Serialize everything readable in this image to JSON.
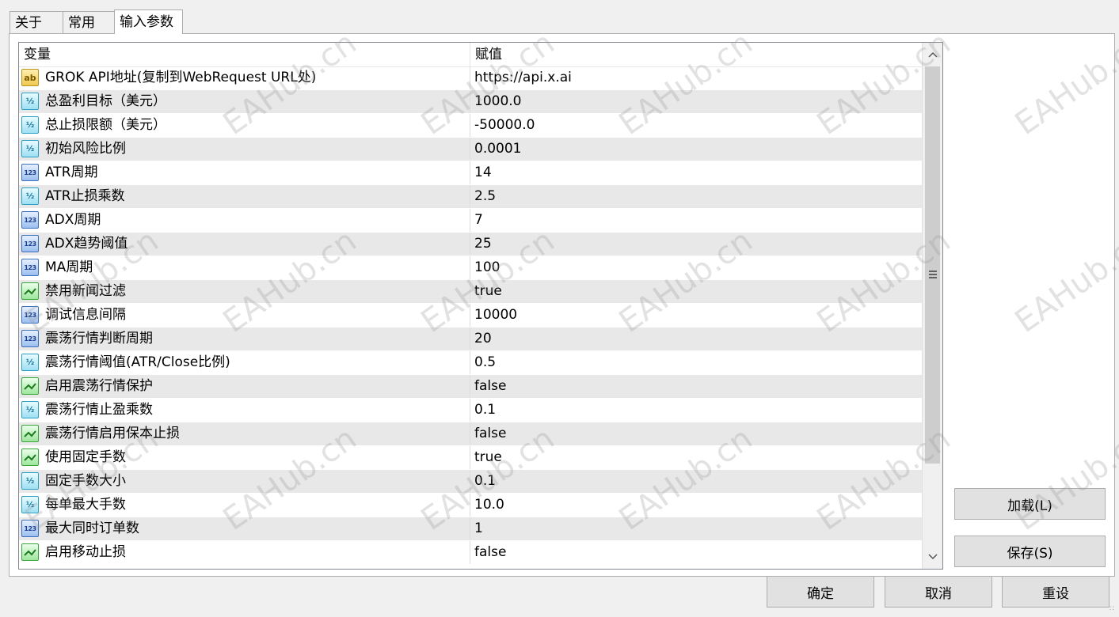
{
  "tabs": [
    {
      "label": "关于"
    },
    {
      "label": "常用"
    },
    {
      "label": "输入参数",
      "active": true
    }
  ],
  "grid": {
    "columns": [
      "变量",
      "赋值"
    ],
    "rows": [
      {
        "type": "string",
        "name": "GROK API地址(复制到WebRequest URL处)",
        "value": "https://api.x.ai"
      },
      {
        "type": "double",
        "name": "总盈利目标（美元）",
        "value": "1000.0"
      },
      {
        "type": "double",
        "name": "总止损限额（美元）",
        "value": "-50000.0"
      },
      {
        "type": "double",
        "name": "初始风险比例",
        "value": "0.0001"
      },
      {
        "type": "int",
        "name": "ATR周期",
        "value": "14"
      },
      {
        "type": "double",
        "name": "ATR止损乘数",
        "value": "2.5"
      },
      {
        "type": "int",
        "name": "ADX周期",
        "value": "7"
      },
      {
        "type": "int",
        "name": "ADX趋势阈值",
        "value": "25"
      },
      {
        "type": "int",
        "name": "MA周期",
        "value": "100"
      },
      {
        "type": "bool",
        "name": "禁用新闻过滤",
        "value": "true"
      },
      {
        "type": "int",
        "name": "调试信息间隔",
        "value": "10000"
      },
      {
        "type": "int",
        "name": "震荡行情判断周期",
        "value": "20"
      },
      {
        "type": "double",
        "name": "震荡行情阈值(ATR/Close比例)",
        "value": "0.5"
      },
      {
        "type": "bool",
        "name": "启用震荡行情保护",
        "value": "false"
      },
      {
        "type": "double",
        "name": "震荡行情止盈乘数",
        "value": "0.1"
      },
      {
        "type": "bool",
        "name": "震荡行情启用保本止损",
        "value": "false"
      },
      {
        "type": "bool",
        "name": "使用固定手数",
        "value": "true"
      },
      {
        "type": "double",
        "name": "固定手数大小",
        "value": "0.1"
      },
      {
        "type": "double",
        "name": "每单最大手数",
        "value": "10.0"
      },
      {
        "type": "int",
        "name": "最大同时订单数",
        "value": "1"
      },
      {
        "type": "bool",
        "name": "启用移动止损",
        "value": "false"
      }
    ]
  },
  "icons": {
    "string": "ab",
    "double": "½",
    "int": "123",
    "bool": "toggle-icon"
  },
  "side_buttons": {
    "load": "加载(L)",
    "save": "保存(S)"
  },
  "footer_buttons": {
    "ok": "确定",
    "cancel": "取消",
    "reset": "重设"
  },
  "watermark": "EAHub.cn"
}
